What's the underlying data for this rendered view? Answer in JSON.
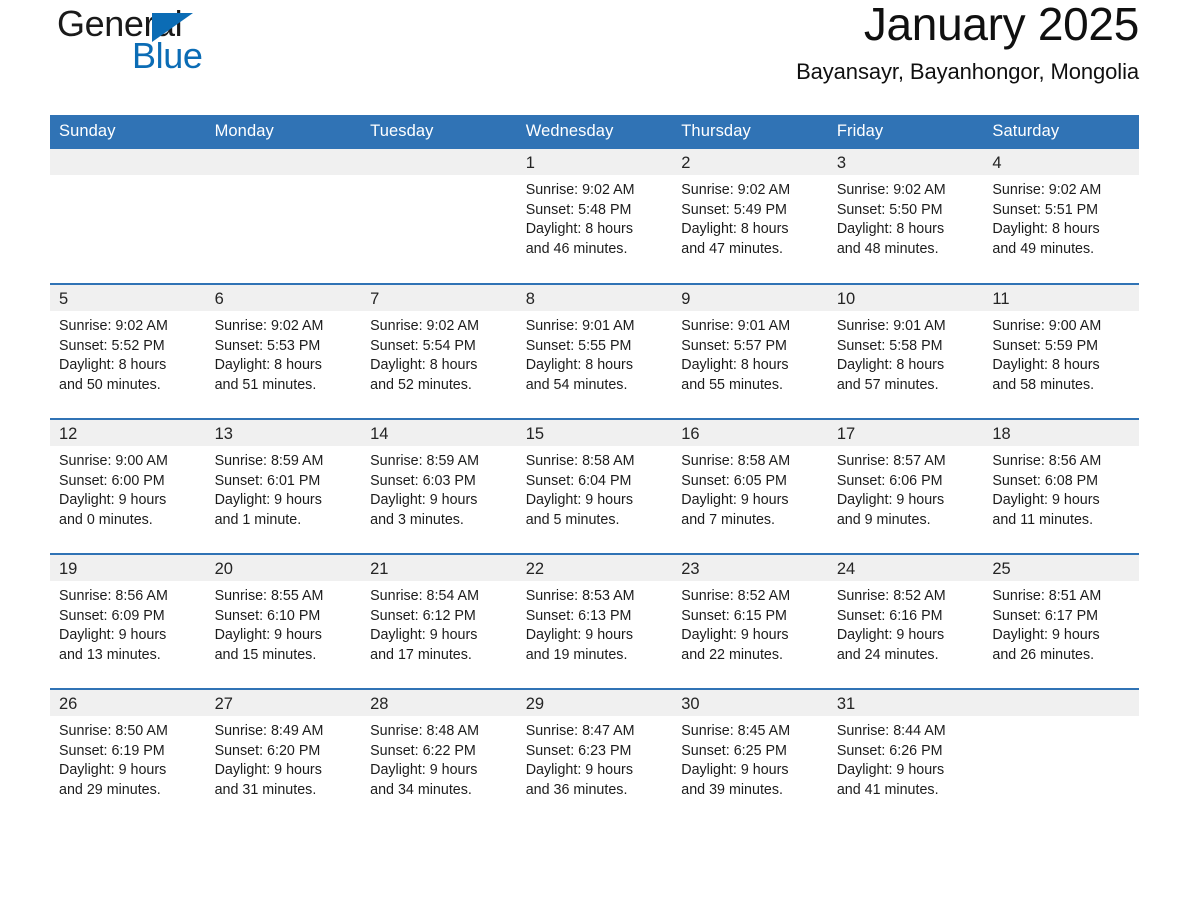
{
  "brand": {
    "name_part1": "General",
    "name_part2": "Blue",
    "accent_color": "#0b6cb5"
  },
  "header": {
    "title": "January 2025",
    "subtitle": "Bayansayr, Bayanhongor, Mongolia"
  },
  "theme": {
    "header_bg": "#3073b5",
    "daynum_bg": "#f0f0f0",
    "row_border": "#3073b5"
  },
  "weekday_headers": [
    "Sunday",
    "Monday",
    "Tuesday",
    "Wednesday",
    "Thursday",
    "Friday",
    "Saturday"
  ],
  "weeks": [
    [
      {
        "day": "",
        "lines": []
      },
      {
        "day": "",
        "lines": []
      },
      {
        "day": "",
        "lines": []
      },
      {
        "day": "1",
        "lines": [
          "Sunrise: 9:02 AM",
          "Sunset: 5:48 PM",
          "Daylight: 8 hours",
          "and 46 minutes."
        ]
      },
      {
        "day": "2",
        "lines": [
          "Sunrise: 9:02 AM",
          "Sunset: 5:49 PM",
          "Daylight: 8 hours",
          "and 47 minutes."
        ]
      },
      {
        "day": "3",
        "lines": [
          "Sunrise: 9:02 AM",
          "Sunset: 5:50 PM",
          "Daylight: 8 hours",
          "and 48 minutes."
        ]
      },
      {
        "day": "4",
        "lines": [
          "Sunrise: 9:02 AM",
          "Sunset: 5:51 PM",
          "Daylight: 8 hours",
          "and 49 minutes."
        ]
      }
    ],
    [
      {
        "day": "5",
        "lines": [
          "Sunrise: 9:02 AM",
          "Sunset: 5:52 PM",
          "Daylight: 8 hours",
          "and 50 minutes."
        ]
      },
      {
        "day": "6",
        "lines": [
          "Sunrise: 9:02 AM",
          "Sunset: 5:53 PM",
          "Daylight: 8 hours",
          "and 51 minutes."
        ]
      },
      {
        "day": "7",
        "lines": [
          "Sunrise: 9:02 AM",
          "Sunset: 5:54 PM",
          "Daylight: 8 hours",
          "and 52 minutes."
        ]
      },
      {
        "day": "8",
        "lines": [
          "Sunrise: 9:01 AM",
          "Sunset: 5:55 PM",
          "Daylight: 8 hours",
          "and 54 minutes."
        ]
      },
      {
        "day": "9",
        "lines": [
          "Sunrise: 9:01 AM",
          "Sunset: 5:57 PM",
          "Daylight: 8 hours",
          "and 55 minutes."
        ]
      },
      {
        "day": "10",
        "lines": [
          "Sunrise: 9:01 AM",
          "Sunset: 5:58 PM",
          "Daylight: 8 hours",
          "and 57 minutes."
        ]
      },
      {
        "day": "11",
        "lines": [
          "Sunrise: 9:00 AM",
          "Sunset: 5:59 PM",
          "Daylight: 8 hours",
          "and 58 minutes."
        ]
      }
    ],
    [
      {
        "day": "12",
        "lines": [
          "Sunrise: 9:00 AM",
          "Sunset: 6:00 PM",
          "Daylight: 9 hours",
          "and 0 minutes."
        ]
      },
      {
        "day": "13",
        "lines": [
          "Sunrise: 8:59 AM",
          "Sunset: 6:01 PM",
          "Daylight: 9 hours",
          "and 1 minute."
        ]
      },
      {
        "day": "14",
        "lines": [
          "Sunrise: 8:59 AM",
          "Sunset: 6:03 PM",
          "Daylight: 9 hours",
          "and 3 minutes."
        ]
      },
      {
        "day": "15",
        "lines": [
          "Sunrise: 8:58 AM",
          "Sunset: 6:04 PM",
          "Daylight: 9 hours",
          "and 5 minutes."
        ]
      },
      {
        "day": "16",
        "lines": [
          "Sunrise: 8:58 AM",
          "Sunset: 6:05 PM",
          "Daylight: 9 hours",
          "and 7 minutes."
        ]
      },
      {
        "day": "17",
        "lines": [
          "Sunrise: 8:57 AM",
          "Sunset: 6:06 PM",
          "Daylight: 9 hours",
          "and 9 minutes."
        ]
      },
      {
        "day": "18",
        "lines": [
          "Sunrise: 8:56 AM",
          "Sunset: 6:08 PM",
          "Daylight: 9 hours",
          "and 11 minutes."
        ]
      }
    ],
    [
      {
        "day": "19",
        "lines": [
          "Sunrise: 8:56 AM",
          "Sunset: 6:09 PM",
          "Daylight: 9 hours",
          "and 13 minutes."
        ]
      },
      {
        "day": "20",
        "lines": [
          "Sunrise: 8:55 AM",
          "Sunset: 6:10 PM",
          "Daylight: 9 hours",
          "and 15 minutes."
        ]
      },
      {
        "day": "21",
        "lines": [
          "Sunrise: 8:54 AM",
          "Sunset: 6:12 PM",
          "Daylight: 9 hours",
          "and 17 minutes."
        ]
      },
      {
        "day": "22",
        "lines": [
          "Sunrise: 8:53 AM",
          "Sunset: 6:13 PM",
          "Daylight: 9 hours",
          "and 19 minutes."
        ]
      },
      {
        "day": "23",
        "lines": [
          "Sunrise: 8:52 AM",
          "Sunset: 6:15 PM",
          "Daylight: 9 hours",
          "and 22 minutes."
        ]
      },
      {
        "day": "24",
        "lines": [
          "Sunrise: 8:52 AM",
          "Sunset: 6:16 PM",
          "Daylight: 9 hours",
          "and 24 minutes."
        ]
      },
      {
        "day": "25",
        "lines": [
          "Sunrise: 8:51 AM",
          "Sunset: 6:17 PM",
          "Daylight: 9 hours",
          "and 26 minutes."
        ]
      }
    ],
    [
      {
        "day": "26",
        "lines": [
          "Sunrise: 8:50 AM",
          "Sunset: 6:19 PM",
          "Daylight: 9 hours",
          "and 29 minutes."
        ]
      },
      {
        "day": "27",
        "lines": [
          "Sunrise: 8:49 AM",
          "Sunset: 6:20 PM",
          "Daylight: 9 hours",
          "and 31 minutes."
        ]
      },
      {
        "day": "28",
        "lines": [
          "Sunrise: 8:48 AM",
          "Sunset: 6:22 PM",
          "Daylight: 9 hours",
          "and 34 minutes."
        ]
      },
      {
        "day": "29",
        "lines": [
          "Sunrise: 8:47 AM",
          "Sunset: 6:23 PM",
          "Daylight: 9 hours",
          "and 36 minutes."
        ]
      },
      {
        "day": "30",
        "lines": [
          "Sunrise: 8:45 AM",
          "Sunset: 6:25 PM",
          "Daylight: 9 hours",
          "and 39 minutes."
        ]
      },
      {
        "day": "31",
        "lines": [
          "Sunrise: 8:44 AM",
          "Sunset: 6:26 PM",
          "Daylight: 9 hours",
          "and 41 minutes."
        ]
      },
      {
        "day": "",
        "lines": []
      }
    ]
  ]
}
